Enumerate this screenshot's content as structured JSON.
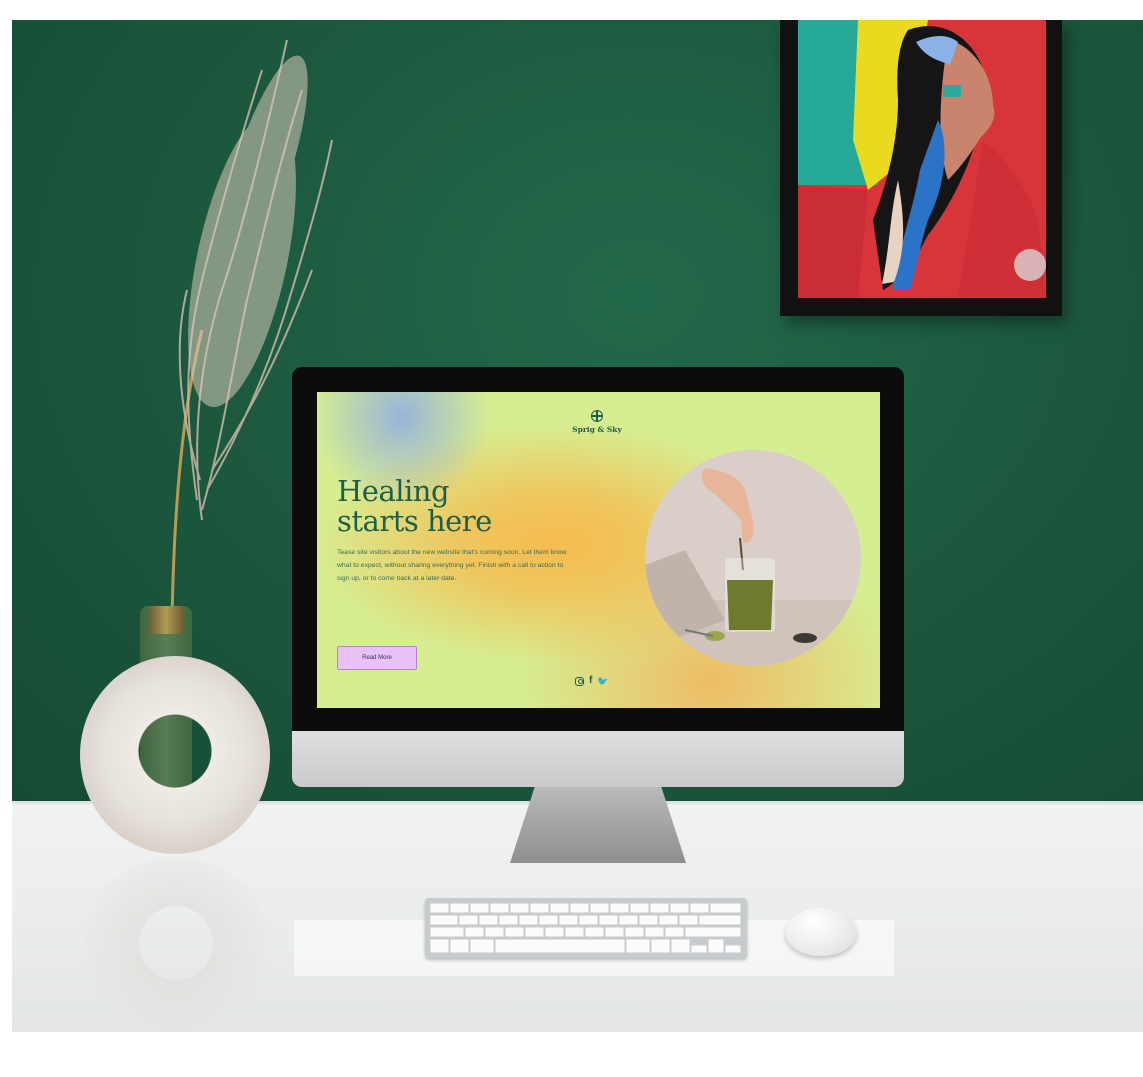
{
  "scene": {
    "description_role": "photo-mockup",
    "wall_color": "#1c5a3f",
    "desk_color": "#ededed"
  },
  "website": {
    "brand": "Sprig & Sky",
    "logo_icon": "compass-icon",
    "hero_title": "Healing\nstarts here",
    "hero_body": "Tease site visitors about the new website that's coming soon. Let them know what to expect, without sharing everything yet. Finish with a call to action to sign up, or to come back at a later date.",
    "cta_label": "Read More",
    "social_icons": [
      "instagram-icon",
      "facebook-icon",
      "twitter-icon"
    ],
    "social_glyphs": {
      "facebook": "f",
      "twitter": "🐦"
    },
    "colors": {
      "primary": "#1d5f4a",
      "background": "#d6ee92",
      "accent_orange": "#f6bb4f",
      "cta_background": "#e8c2f6"
    }
  }
}
